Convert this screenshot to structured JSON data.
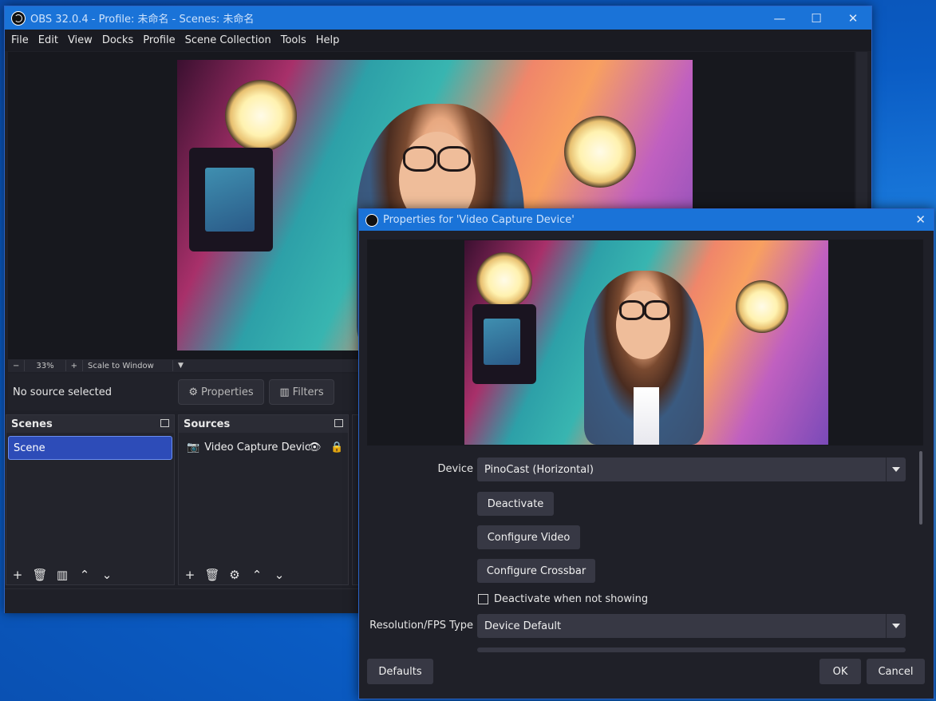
{
  "main_window": {
    "title": "OBS 32.0.4 - Profile: 未命名 - Scenes: 未命名",
    "menu": [
      "File",
      "Edit",
      "View",
      "Docks",
      "Profile",
      "Scene Collection",
      "Tools",
      "Help"
    ],
    "zoom_minus": "−",
    "zoom_value": "33%",
    "zoom_plus": "+",
    "scale_mode": "Scale to Window",
    "no_source": "No source selected",
    "properties_label": "Properties",
    "filters_label": "Filters",
    "scenes_title": "Scenes",
    "scene_items": [
      "Scene"
    ],
    "sources_title": "Sources",
    "source_items": [
      "Video Capture Devic"
    ]
  },
  "dialog": {
    "title": "Properties for 'Video Capture Device'",
    "device_label": "Device",
    "device_value": "PinoCast (Horizontal)",
    "deactivate": "Deactivate",
    "configure_video": "Configure Video",
    "configure_crossbar": "Configure Crossbar",
    "deactivate_when_hidden": "Deactivate when not showing",
    "resfps_label": "Resolution/FPS Type",
    "resfps_value": "Device Default",
    "defaults": "Defaults",
    "ok": "OK",
    "cancel": "Cancel"
  },
  "colors": {
    "titlebar": "#1a73d8",
    "selected_scene": "#2d4cb8",
    "panel": "#23242c"
  },
  "icons": {
    "window": [
      "minimize-icon",
      "maximize-icon",
      "close-icon"
    ],
    "scene_footer": [
      "add-icon",
      "trash-icon",
      "filter-icon",
      "up-icon",
      "down-icon"
    ],
    "source_footer": [
      "add-icon",
      "trash-icon",
      "gear-icon",
      "up-icon",
      "down-icon"
    ]
  }
}
